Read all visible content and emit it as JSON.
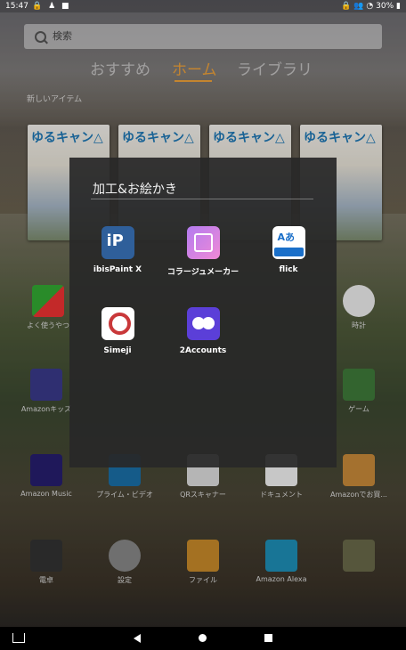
{
  "status_bar": {
    "time": "15:47",
    "battery": "30%"
  },
  "search": {
    "placeholder": "検索"
  },
  "tabs": [
    {
      "label": "おすすめ",
      "active": false
    },
    {
      "label": "ホーム",
      "active": true
    },
    {
      "label": "ライブラリ",
      "active": false
    }
  ],
  "section": {
    "new_items": "新しいアイテム"
  },
  "books": [
    {
      "title": "ゆるキャン△"
    },
    {
      "title": "ゆるキャン△"
    },
    {
      "title": "ゆるキャン△"
    },
    {
      "title": "ゆるキャン△"
    }
  ],
  "background_apps": [
    {
      "label": "よく使うやつ"
    },
    {
      "label": "時計"
    },
    {
      "label": "Amazonキッズ"
    },
    {
      "label": "ゲーム"
    },
    {
      "label": "Amazon Music"
    },
    {
      "label": "プライム・ビデオ"
    },
    {
      "label": "QRスキャナー"
    },
    {
      "label": "ドキュメント"
    },
    {
      "label": "Amazonでお買..."
    },
    {
      "label": "電卓"
    },
    {
      "label": "設定"
    },
    {
      "label": "ファイル"
    },
    {
      "label": "Amazon Alexa"
    }
  ],
  "folder": {
    "title": "加工&お絵かき",
    "apps": [
      {
        "label": "ibisPaint X",
        "icon": "ibispaint-icon"
      },
      {
        "label": "コラージュメーカー",
        "icon": "collage-maker-icon"
      },
      {
        "label": "flick",
        "icon": "flick-keyboard-icon"
      },
      {
        "label": "Simeji",
        "icon": "simeji-icon"
      },
      {
        "label": "2Accounts",
        "icon": "2accounts-icon"
      }
    ]
  },
  "colors": {
    "accent": "#f0a33a",
    "folder_bg": "#282828"
  }
}
